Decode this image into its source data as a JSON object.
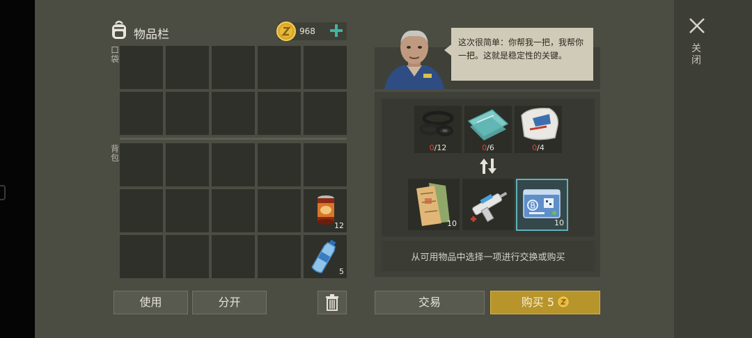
{
  "inventory": {
    "title": "物品栏",
    "coins": "968",
    "pocket_label": "口袋",
    "backpack_label": "背包",
    "items": [
      {
        "name": "canned-food",
        "count": "12"
      },
      {
        "name": "water-bottle",
        "count": "5"
      }
    ],
    "use_label": "使用",
    "split_label": "分开"
  },
  "npc": {
    "speech": "这次很简单：你帮我一把，我帮你一把。这就是稳定性的关键。"
  },
  "trade": {
    "requirements": [
      {
        "name": "rubber-seals",
        "have": "0",
        "need": "/12"
      },
      {
        "name": "glass-sheets",
        "have": "0",
        "need": "/6"
      },
      {
        "name": "cement-bag",
        "have": "0",
        "need": "/4"
      }
    ],
    "offers": [
      {
        "name": "maps",
        "count": "10"
      },
      {
        "name": "syringe-gun",
        "count": ""
      },
      {
        "name": "sector-b-keycard",
        "count": "10"
      }
    ],
    "hint": "从可用物品中选择一项进行交换或购买",
    "trade_label": "交易",
    "buy_label": "购买",
    "buy_price": "5"
  },
  "close_label": "关闭",
  "colors": {
    "accent_teal": "#5fb3bb",
    "gold": "#b8952a",
    "warning_red": "#e0423a"
  }
}
